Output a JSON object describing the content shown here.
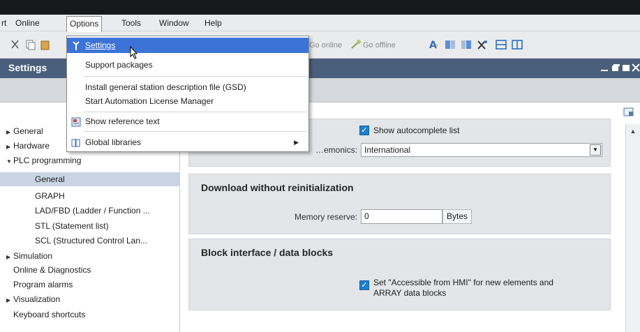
{
  "menubar": {
    "items": [
      {
        "label": "rt"
      },
      {
        "label": "Online"
      },
      {
        "label": "Options"
      },
      {
        "label": "Tools"
      },
      {
        "label": "Window"
      },
      {
        "label": "Help"
      }
    ]
  },
  "toolbar": {
    "go_online": "Go online",
    "go_offline": "Go offline"
  },
  "options_menu": {
    "items": [
      {
        "label": "Settings",
        "icon": "wrench-icon"
      },
      {
        "label": "Support packages"
      },
      {
        "label": "Install general station description file (GSD)"
      },
      {
        "label": "Start Automation License Manager"
      },
      {
        "label": "Show reference text",
        "icon": "reference-text-icon"
      },
      {
        "label": "Global libraries",
        "icon": "library-icon"
      }
    ]
  },
  "window": {
    "title": "Settings"
  },
  "tree": {
    "items": [
      {
        "label": "General",
        "arrow": "▶"
      },
      {
        "label": "Hardware",
        "arrow": "▶"
      },
      {
        "label": "PLC programming",
        "arrow": "▼"
      },
      {
        "label": "General"
      },
      {
        "label": "GRAPH"
      },
      {
        "label": "LAD/FBD (Ladder / Function ..."
      },
      {
        "label": "STL (Statement list)"
      },
      {
        "label": "SCL (Structured Control Lan..."
      },
      {
        "label": "Simulation",
        "arrow": "▶"
      },
      {
        "label": "Online & Diagnostics"
      },
      {
        "label": "Program alarms"
      },
      {
        "label": "Visualization",
        "arrow": "▶"
      },
      {
        "label": "Keyboard shortcuts"
      }
    ]
  },
  "general_section": {
    "autocomplete_label": "Show autocomplete list",
    "autocomplete_checked": true,
    "mnemonics_label": "…emonics:",
    "mnemonics_value": "International"
  },
  "download_section": {
    "title": "Download without reinitialization",
    "memory_label": "Memory reserve:",
    "memory_value": "0",
    "memory_unit": "Bytes"
  },
  "block_section": {
    "title": "Block interface / data blocks",
    "hmi_label_line1": "Set \"Accessible from HMI\" for new elements and",
    "hmi_label_line2": "ARRAY data blocks",
    "hmi_checked": true
  },
  "colors": {
    "title_bar": "#4a5f7b",
    "menu_highlight": "#3c73d6",
    "checkbox": "#1f7fd0",
    "tree_selected": "#c9d5e3"
  }
}
